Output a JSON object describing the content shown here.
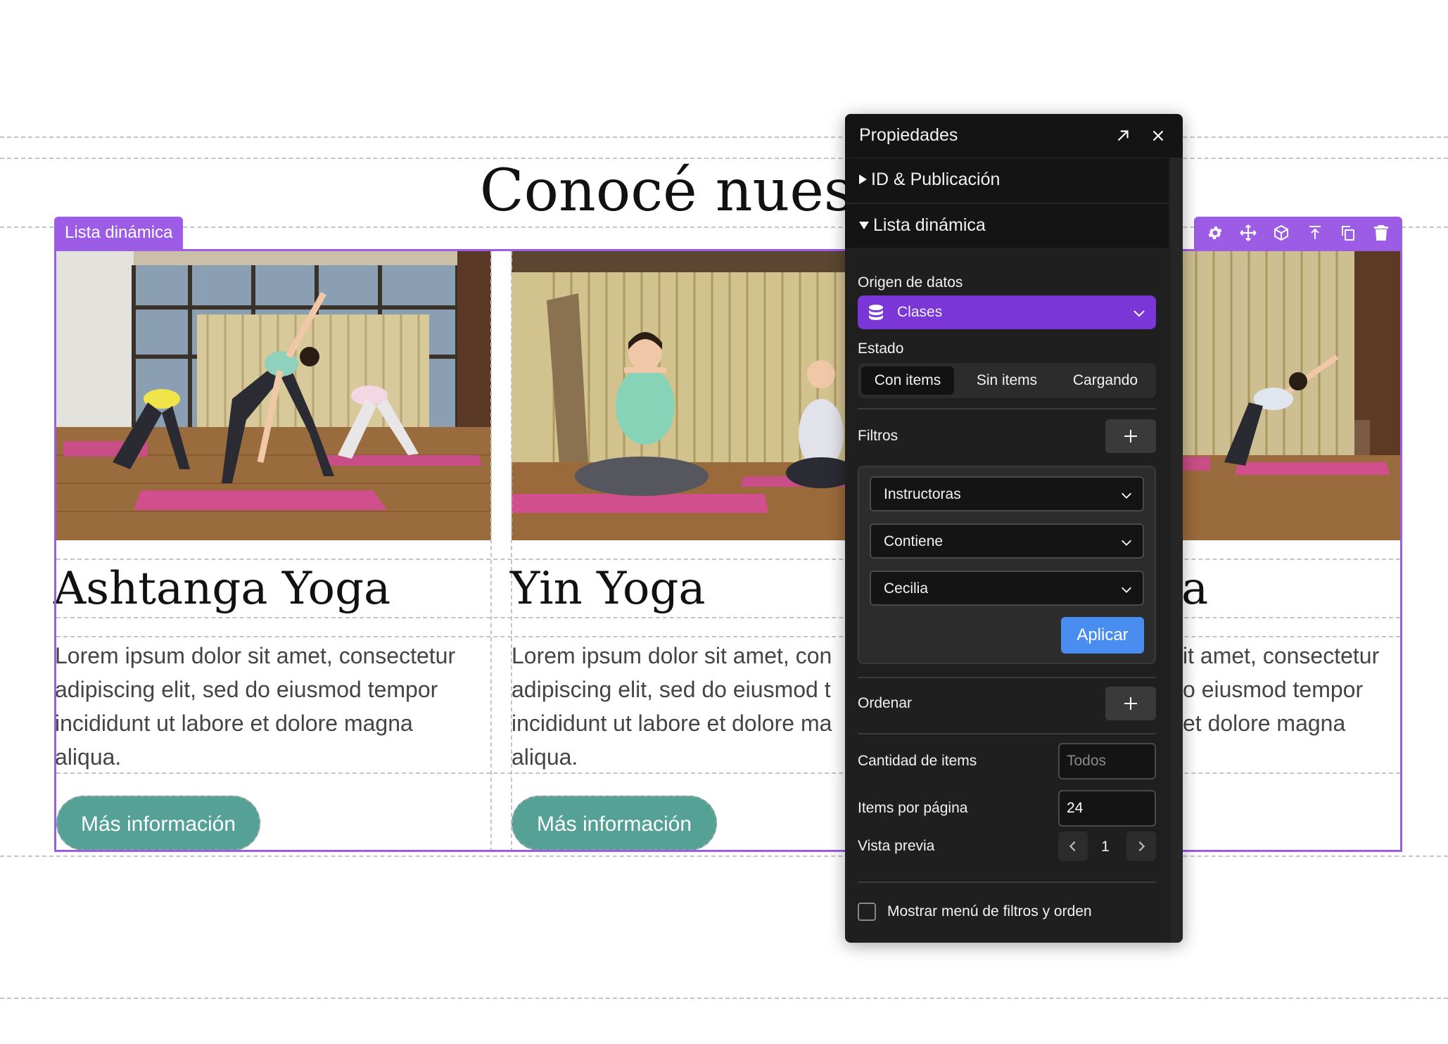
{
  "page": {
    "heading": "Conocé nuestras"
  },
  "list": {
    "tag_label": "Lista dinámica",
    "toolbar_icons": [
      "gear-icon",
      "move-icon",
      "cube-icon",
      "move-to-top-icon",
      "duplicate-icon",
      "trash-icon"
    ]
  },
  "cards": [
    {
      "title": "Ashtanga Yoga",
      "text": "Lorem ipsum dolor sit amet, consectetur\nadipiscing elit, sed do eiusmod tempor\nincididunt ut labore et dolore magna\naliqua.",
      "button": "Más información"
    },
    {
      "title": "Yin Yoga",
      "text": "Lorem ipsum dolor sit amet, con\nadipiscing elit, sed do eiusmod t\nincididunt ut labore et dolore ma\naliqua.",
      "button": "Más información"
    },
    {
      "title": "a",
      "text": "it amet, consectetur\no eiusmod tempor\net dolore magna"
    }
  ],
  "panel": {
    "title": "Propiedades",
    "section_id": "ID & Publicación",
    "section_list": "Lista dinámica",
    "data_source_label": "Origen de datos",
    "data_source_value": "Clases",
    "state_label": "Estado",
    "state_options": [
      "Con items",
      "Sin items",
      "Cargando"
    ],
    "state_selected": "Con items",
    "filters_label": "Filtros",
    "filter_field": "Instructoras",
    "filter_operator": "Contiene",
    "filter_value": "Cecilia",
    "apply_label": "Aplicar",
    "sort_label": "Ordenar",
    "quantity_label": "Cantidad de items",
    "quantity_placeholder": "Todos",
    "per_page_label": "Items por página",
    "per_page_value": "24",
    "preview_label": "Vista previa",
    "preview_page": "1",
    "show_menu_label": "Mostrar menú de filtros y orden",
    "show_menu_checked": false
  },
  "colors": {
    "selection": "#9c5ce6",
    "button": "#55a196",
    "panel_bg": "#1f1f1f",
    "source_dropdown": "#7b36d8",
    "apply_button": "#4a8df0"
  }
}
